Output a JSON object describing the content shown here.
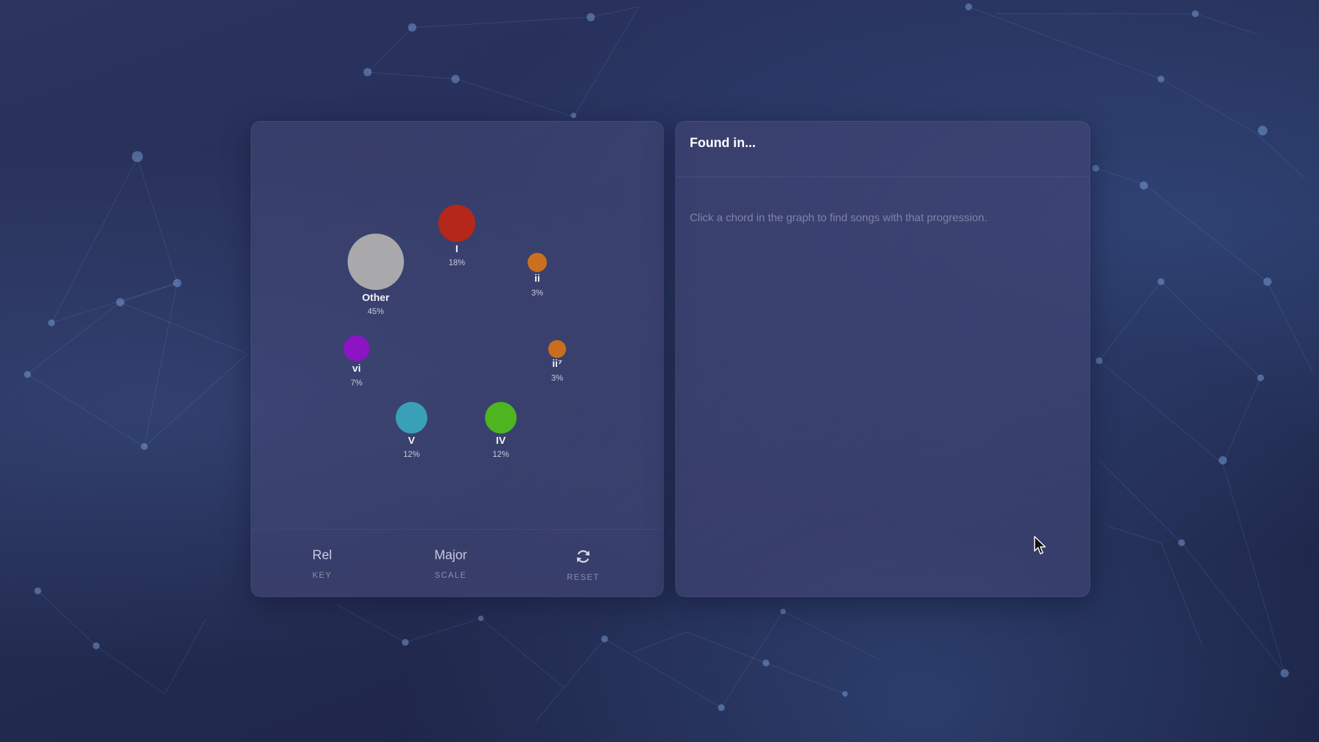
{
  "graph": {
    "nodes": [
      {
        "id": "other",
        "label": "Other",
        "percent": "45%",
        "color": "#a9a9ab"
      },
      {
        "id": "I",
        "label": "I",
        "percent": "18%",
        "color": "#b5261b"
      },
      {
        "id": "ii",
        "label": "ii",
        "percent": "3%",
        "color": "#cc6f1f"
      },
      {
        "id": "vi",
        "label": "vi",
        "percent": "7%",
        "color": "#8b14c4"
      },
      {
        "id": "ii7",
        "label": "ii⁷",
        "percent": "3%",
        "color": "#c96d1e"
      },
      {
        "id": "V",
        "label": "V",
        "percent": "12%",
        "color": "#3aa0b8"
      },
      {
        "id": "IV",
        "label": "IV",
        "percent": "12%",
        "color": "#4db51f"
      }
    ]
  },
  "controls": {
    "key": {
      "value": "Rel",
      "caption": "KEY"
    },
    "scale": {
      "value": "Major",
      "caption": "SCALE"
    },
    "reset": {
      "icon": "refresh-icon",
      "caption": "RESET"
    }
  },
  "found_panel": {
    "title": "Found in...",
    "hint": "Click a chord in the graph to find songs with that progression."
  },
  "colors": {
    "panel_bg": "#464878",
    "text_primary": "#ffffff",
    "text_muted": "#7f83a6"
  }
}
